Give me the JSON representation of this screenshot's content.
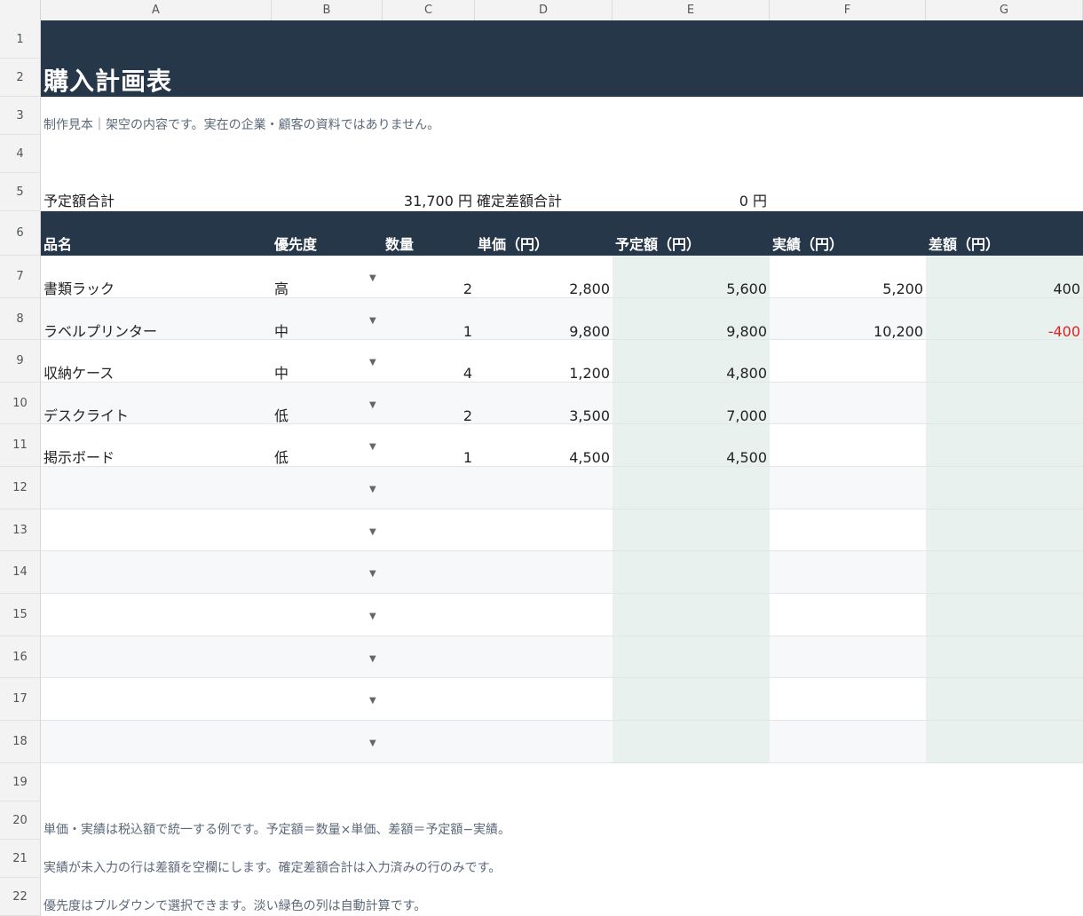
{
  "columns": [
    "A",
    "B",
    "C",
    "D",
    "E",
    "F",
    "G"
  ],
  "rows": [
    "1",
    "2",
    "3",
    "4",
    "5",
    "6",
    "7",
    "8",
    "9",
    "10",
    "11",
    "12",
    "13",
    "14",
    "15",
    "16",
    "17",
    "18",
    "19",
    "20",
    "21",
    "22"
  ],
  "title": "購入計画表",
  "subtitle": "制作見本｜架空の内容です。実在の企業・顧客の資料ではありません。",
  "summary": {
    "planned_label": "予定額合計",
    "planned_value": "31,700 円",
    "diff_label": "確定差額合計",
    "diff_value": "0 円"
  },
  "table": {
    "headers": [
      "品名",
      "優先度",
      "数量",
      "単価（円）",
      "予定額（円）",
      "実績（円）",
      "差額（円）"
    ],
    "items": [
      {
        "name": "書類ラック",
        "priority": "高",
        "qty": "2",
        "price": "2,800",
        "planned": "5,600",
        "actual": "5,200",
        "diff": "400"
      },
      {
        "name": "ラベルプリンター",
        "priority": "中",
        "qty": "1",
        "price": "9,800",
        "planned": "9,800",
        "actual": "10,200",
        "diff": "-400"
      },
      {
        "name": "収納ケース",
        "priority": "中",
        "qty": "4",
        "price": "1,200",
        "planned": "4,800",
        "actual": "",
        "diff": ""
      },
      {
        "name": "デスクライト",
        "priority": "低",
        "qty": "2",
        "price": "3,500",
        "planned": "7,000",
        "actual": "",
        "diff": ""
      },
      {
        "name": "掲示ボード",
        "priority": "低",
        "qty": "1",
        "price": "4,500",
        "planned": "4,500",
        "actual": "",
        "diff": ""
      }
    ],
    "dropdown_icon": "triangle-down-icon"
  },
  "notes": [
    "単価・実績は税込額で統一する例です。予定額＝数量×単価、差額＝予定額−実績。",
    "実績が未入力の行は差額を空欄にします。確定差額合計は入力済みの行のみです。",
    "優先度はプルダウンで選択できます。淡い緑色の列は自動計算です。"
  ],
  "colors": {
    "header_bg": "#26374a",
    "calc_bg": "#e9f1ef",
    "negative": "#e02020"
  }
}
